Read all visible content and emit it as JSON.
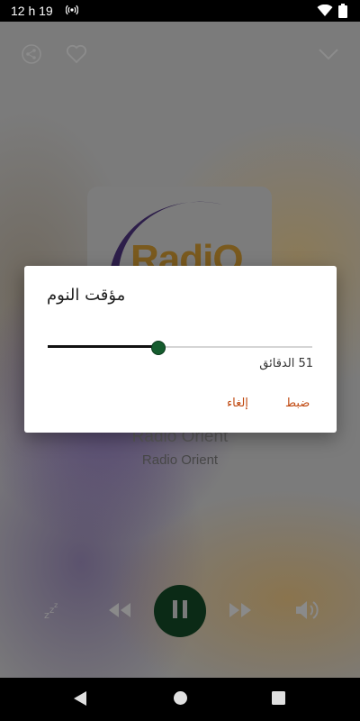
{
  "status_bar": {
    "time": "12 h 19",
    "icons": [
      "hotspot-icon",
      "wifi-icon",
      "battery-icon"
    ]
  },
  "player": {
    "top_icons": [
      "share-icon",
      "heart-icon",
      "chevron-down-icon"
    ],
    "cover_logo_text": "RadiO",
    "station_name": "Radio Orient",
    "station_subtitle": "Radio Orient",
    "controls": [
      "sleep-icon",
      "rewind-icon",
      "pause-icon",
      "fast-forward-icon",
      "volume-icon"
    ],
    "colors": {
      "pause_button": "#0b2a16"
    }
  },
  "sleep_dialog": {
    "title": "مؤقت النوم",
    "slider_value_fraction": 0.414,
    "minutes_label": "51 الدقائق",
    "set_button": "ضبط",
    "cancel_button": "إلغاء",
    "colors": {
      "accent": "#c04a12",
      "thumb": "#155c2e"
    }
  },
  "nav_bar": {
    "icons": [
      "back-icon",
      "home-icon",
      "recents-icon"
    ]
  }
}
